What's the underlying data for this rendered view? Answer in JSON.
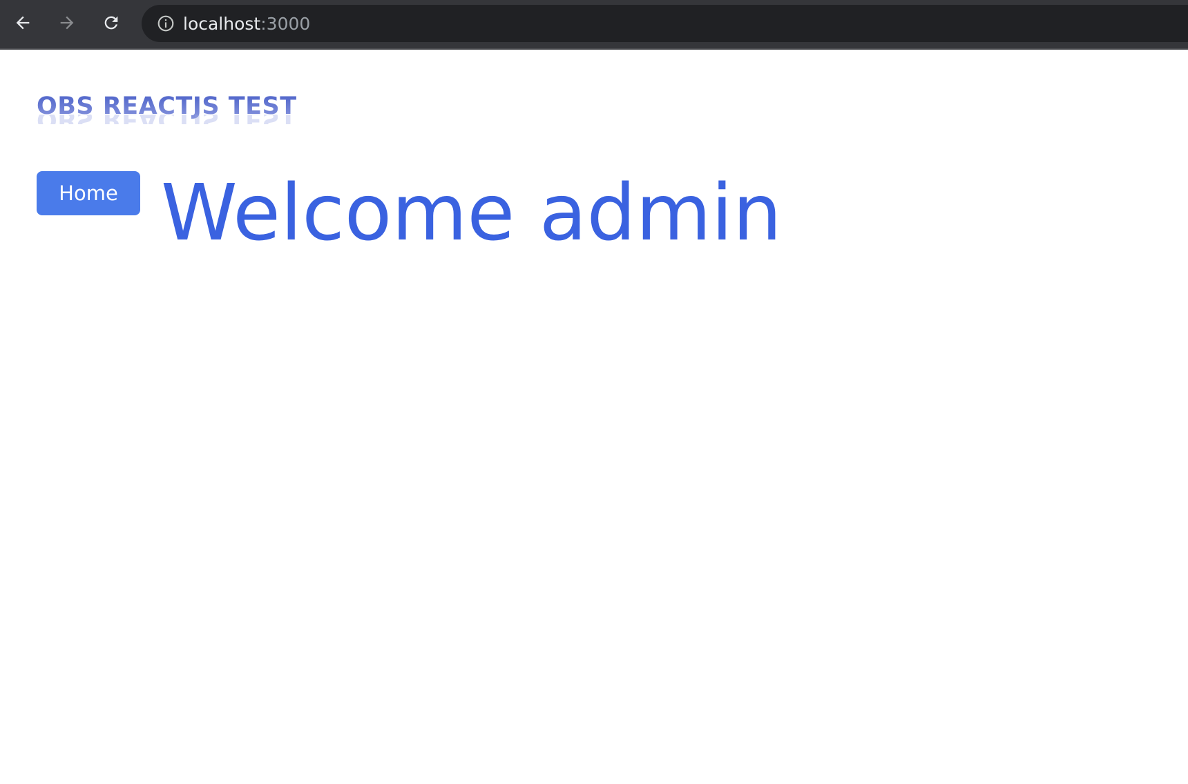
{
  "browser": {
    "url_host": "localhost",
    "url_port": ":3000",
    "icons": [
      "back-arrow-icon",
      "forward-arrow-icon",
      "reload-icon",
      "info-icon"
    ]
  },
  "header": {
    "site_title": "OBS REACTJS TEST"
  },
  "main": {
    "home_button_label": "Home",
    "welcome_heading": "Welcome admin"
  },
  "colors": {
    "browser_bar": "#35363a",
    "omnibox": "#202124",
    "button": "#4a7bea",
    "heading": "#3a62e0",
    "title": "#5b6fcf"
  }
}
